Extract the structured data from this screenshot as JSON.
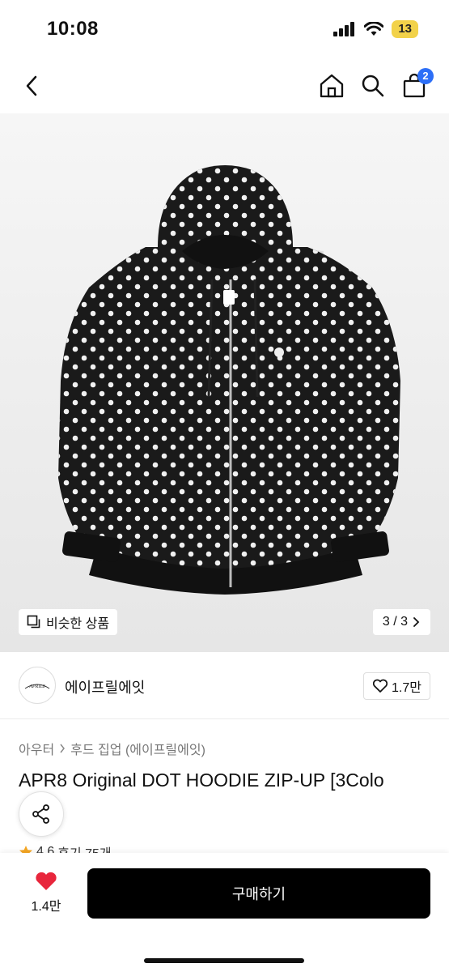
{
  "status_bar": {
    "time": "10:08",
    "battery": "13"
  },
  "nav": {
    "cart_count": "2"
  },
  "hero": {
    "similar_label": "비슷한 상품",
    "pager": "3 / 3"
  },
  "seller": {
    "name": "에이프릴에잇",
    "logo_text": "APRIL8",
    "likes": "1.7만"
  },
  "product": {
    "breadcrumb": [
      "아우터",
      "후드 집업 (에이프릴에잇)"
    ],
    "title": "APR8 Original DOT HOODIE ZIP-UP [3Colo",
    "rating": "4.6",
    "reviews": "후기 75개"
  },
  "bottom": {
    "wish_count": "1.4만",
    "buy_label": "구매하기"
  },
  "colors": {
    "accent": "#2d6ff7",
    "heart": "#e8263c",
    "star": "#f5a623"
  }
}
